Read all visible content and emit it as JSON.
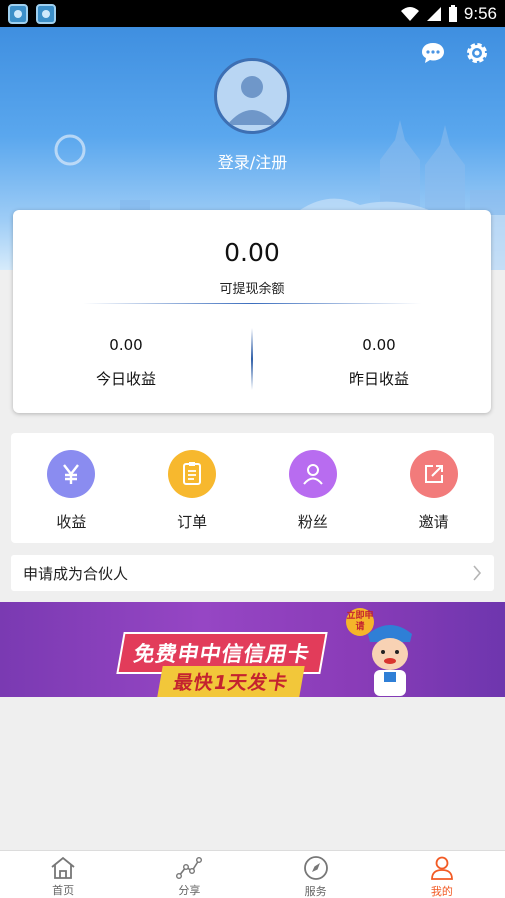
{
  "status_bar": {
    "time": "9:56",
    "app_icons": [
      "app-icon",
      "app-icon"
    ]
  },
  "header": {
    "login_text": "登录/注册",
    "icons": [
      "chat-bubble-icon",
      "gear-icon"
    ]
  },
  "balance": {
    "value": "0.00",
    "label": "可提现余额",
    "today": {
      "value": "0.00",
      "label": "今日收益"
    },
    "yesterday": {
      "value": "0.00",
      "label": "昨日收益"
    }
  },
  "menu": {
    "items": [
      {
        "label": "收益",
        "icon": "yen-icon",
        "color": "#8a8cf0"
      },
      {
        "label": "订单",
        "icon": "clipboard-icon",
        "color": "#f7b82e"
      },
      {
        "label": "粉丝",
        "icon": "user-icon",
        "color": "#b86cf0"
      },
      {
        "label": "邀请",
        "icon": "share-icon",
        "color": "#f27b7b"
      }
    ]
  },
  "partner": {
    "label": "申请成为合伙人"
  },
  "banner": {
    "line1": "免费申中信信用卡",
    "line2": "最快1天发卡",
    "badge": "立即申请"
  },
  "bottom_nav": {
    "active_color": "#f25a24",
    "items": [
      {
        "label": "首页",
        "icon": "home-icon"
      },
      {
        "label": "分享",
        "icon": "share-graph-icon"
      },
      {
        "label": "服务",
        "icon": "compass-icon"
      },
      {
        "label": "我的",
        "icon": "person-icon",
        "active": true
      }
    ]
  }
}
